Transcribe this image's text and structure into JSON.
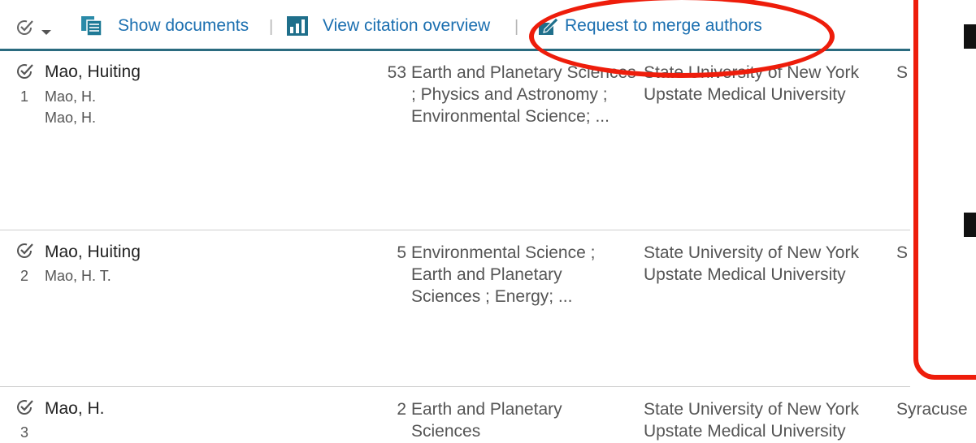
{
  "toolbar": {
    "show_documents": "Show documents",
    "view_citation_overview": "View citation overview",
    "request_merge": "Request to merge authors",
    "separator": "|"
  },
  "results": [
    {
      "rank": "1",
      "name": "Mao, Huiting",
      "variants": [
        "Mao, H.",
        "Mao, H."
      ],
      "documents": "53",
      "subjects": "Earth and Planetary Sciences ; Physics and Astronomy ; Environmental Science; ...",
      "affiliation": "State University of New York Upstate Medical University",
      "city": "S"
    },
    {
      "rank": "2",
      "name": "Mao, Huiting",
      "variants": [
        "Mao, H. T."
      ],
      "documents": "5",
      "subjects": "Environmental Science ; Earth and Planetary Sciences ; Energy; ...",
      "affiliation": "State University of New York Upstate Medical University",
      "city": "S"
    },
    {
      "rank": "3",
      "name": "Mao, H.",
      "variants": [],
      "documents": "2",
      "subjects": "Earth and Planetary Sciences",
      "affiliation": "State University of New York Upstate Medical University",
      "city": "Syracuse"
    }
  ],
  "colors": {
    "link": "#1b6fb0",
    "annotation_red": "#ee1d0b",
    "toolbar_rule": "#2a6b7f"
  }
}
